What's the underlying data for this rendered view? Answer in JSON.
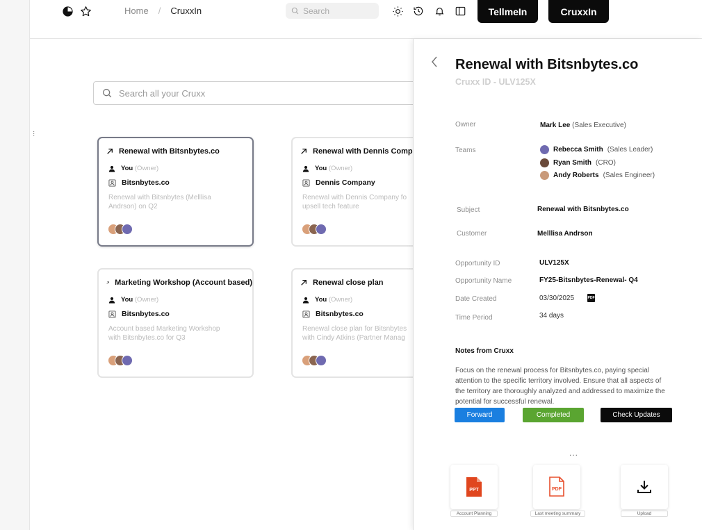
{
  "topbar": {
    "breadcrumb_home": "Home",
    "breadcrumb_sep": "/",
    "breadcrumb_current": "CruxxIn",
    "search_placeholder": "Search",
    "btn_tellmein": "TellmeIn",
    "btn_cruxxin": "CruxxIn"
  },
  "main": {
    "search_placeholder": "Search all your Cruxx"
  },
  "cards": [
    {
      "title": "Renewal with Bitsnbytes.co",
      "owner": "You",
      "owner_role": "(Owner)",
      "company": "Bitsnbytes.co",
      "desc1": "Renewal with Bitsnbytes (Melllisa",
      "desc2": "Andrson) on Q2"
    },
    {
      "title": "Renewal with Dennis Company",
      "owner": "You",
      "owner_role": "(Owner)",
      "company": "Dennis Company",
      "desc1": "Renewal with Dennis Company fo",
      "desc2": "upsell tech feature"
    },
    {
      "title": "Marketing Workshop (Account based)",
      "owner": "You",
      "owner_role": "(Owner)",
      "company": "Bitsnbytes.co",
      "desc1": "Account based Marketing Workshop",
      "desc2": "with Bitsnbytes.co for Q3"
    },
    {
      "title": "Renewal close plan",
      "owner": "You",
      "owner_role": "(Owner)",
      "company": "Bitsnbytes.co",
      "desc1": "Renewal close plan for Bitsnbytes",
      "desc2": "with Cindy Atkins (Partner Manag"
    }
  ],
  "panel": {
    "title": "Renewal with Bitsnbytes.co",
    "subtitle": "Cruxx ID - ULV125X",
    "owner_label": "Owner",
    "owner_name": "Mark Lee",
    "owner_role": "(Sales Executive)",
    "teams_label": "Teams",
    "teams": [
      {
        "name": "Rebecca Smith",
        "role": "(Sales Leader)"
      },
      {
        "name": "Ryan Smith",
        "role": "(CRO)"
      },
      {
        "name": "Andy Roberts",
        "role": "(Sales Engineer)"
      }
    ],
    "subject_label": "Subject",
    "subject": "Renewal with Bitsnbytes.co",
    "customer_label": "Customer",
    "customer": "Melllisa Andrson",
    "opp_id_label": "Opportunity ID",
    "opp_id": "ULV125X",
    "opp_name_label": "Opportunity Name",
    "opp_name": "FY25-Bitsnbytes-Renewal- Q4",
    "date_label": "Date Created",
    "date": "03/30/2025",
    "pdf_tag": "PDF",
    "period_label": "Time Period",
    "period": "34 days",
    "notes_heading": "Notes from Cruxx",
    "notes": "Focus on the renewal process for Bitsnbytes.co, paying special attention to the specific territory involved. Ensure that all aspects of the territory are thoroughly analyzed and addressed to maximize the potential for successful renewal.",
    "btn_forward": "Forward",
    "btn_completed": "Completed",
    "btn_check": "Check Updates",
    "ellipsis": "...",
    "files": [
      {
        "icon_text": "PPT",
        "caption": "Account Planning"
      },
      {
        "icon_text": "PDF",
        "caption": "Last meeting summary"
      },
      {
        "icon_text": "",
        "caption": "Upload"
      }
    ]
  },
  "colors": {
    "forward": "#1a7fe0",
    "completed": "#5aa531",
    "check_updates": "#0b0b0b",
    "ppt": "#e0461e",
    "pdf": "#e8502e"
  },
  "icons": [
    "pie-chart-icon",
    "star-icon",
    "search-icon",
    "sun-icon",
    "history-icon",
    "bell-icon",
    "sidebar-toggle-icon",
    "arrow-up-right-icon",
    "user-icon",
    "building-icon",
    "chevron-left-icon",
    "download-icon"
  ]
}
